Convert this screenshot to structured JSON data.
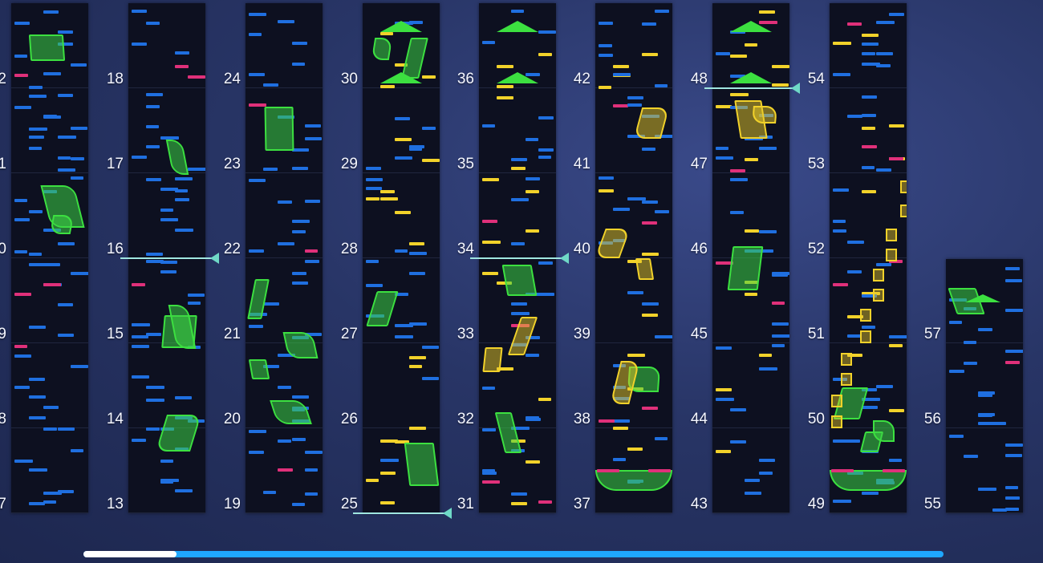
{
  "columns": [
    {
      "labels": [
        "7",
        "8",
        "9",
        "0",
        "1",
        "2"
      ]
    },
    {
      "labels": [
        "13",
        "14",
        "15",
        "16",
        "17",
        "18"
      ]
    },
    {
      "labels": [
        "19",
        "20",
        "21",
        "22",
        "23",
        "24"
      ]
    },
    {
      "labels": [
        "25",
        "26",
        "27",
        "28",
        "29",
        "30"
      ]
    },
    {
      "labels": [
        "31",
        "32",
        "33",
        "34",
        "35",
        "36"
      ]
    },
    {
      "labels": [
        "37",
        "38",
        "39",
        "40",
        "41",
        "42"
      ]
    },
    {
      "labels": [
        "43",
        "44",
        "45",
        "46",
        "47",
        "48"
      ]
    },
    {
      "labels": [
        "49",
        "50",
        "51",
        "52",
        "53",
        "54"
      ]
    },
    {
      "labels": [
        "55",
        "56",
        "57"
      ]
    }
  ],
  "colors": {
    "tap": "#1f6fe0",
    "flick": "#f2d22a",
    "hold": "#3ce040",
    "danger": "#e0307a",
    "background": "#283566",
    "column": "#0d1020",
    "scroll_track": "#1fa7ff",
    "scroll_thumb": "#ffffff"
  },
  "scroll": {
    "position": 0.1
  }
}
